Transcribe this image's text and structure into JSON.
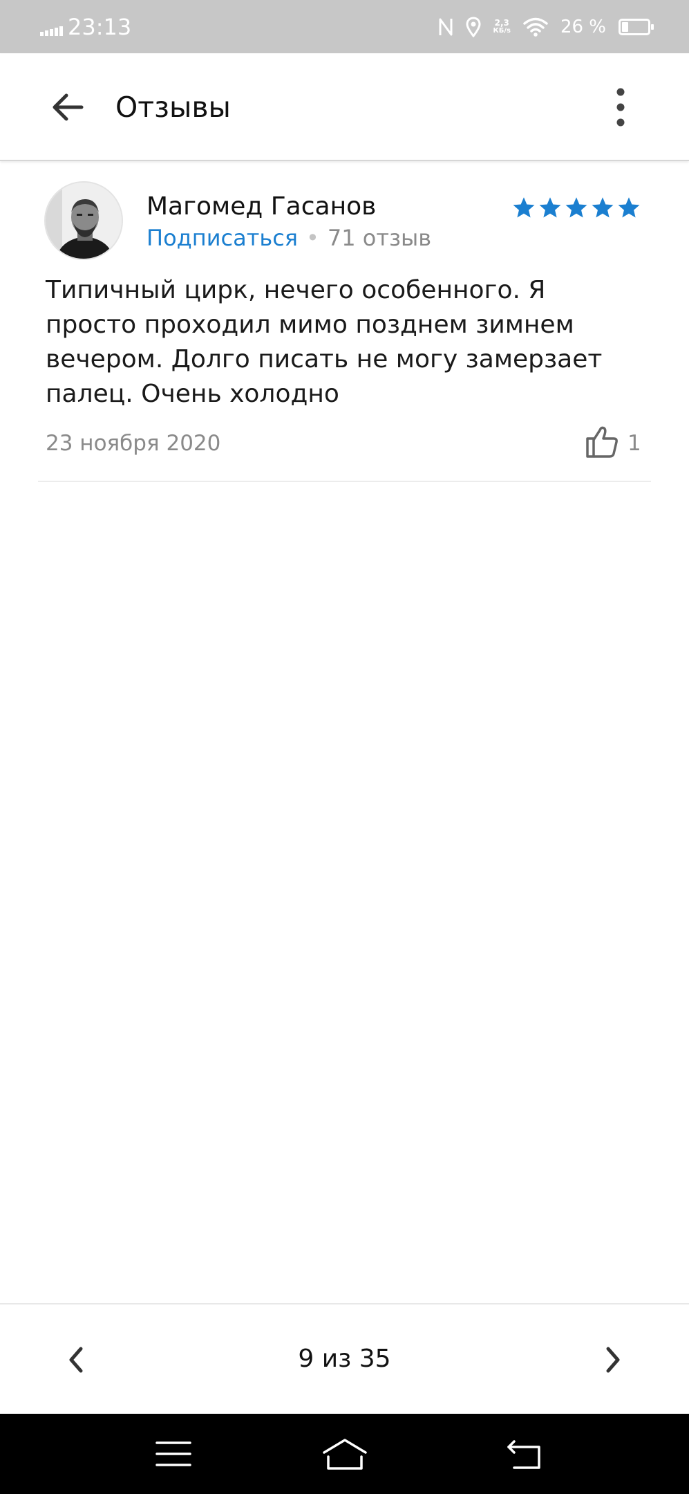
{
  "status_bar": {
    "time": "23:13",
    "speed_value": "2,3",
    "speed_unit": "КБ/s",
    "battery_percent": "26 %",
    "battery_level": 0.26,
    "icons": [
      "signal-icon",
      "nfc-icon",
      "location-icon",
      "wifi-icon",
      "battery-icon"
    ]
  },
  "app_bar": {
    "title": "Отзывы",
    "back_icon": "arrow-back-icon",
    "more_icon": "more-vert-icon"
  },
  "review": {
    "author": "Магомед Гасанов",
    "subscribe_label": "Подписаться",
    "separator": "•",
    "reviews_count": "71 отзыв",
    "rating": 5,
    "rating_max": 5,
    "text": "Типичный цирк, нечего особенного. Я просто проходил мимо позднем зимнем вечером. Долго писать не могу замерзает палец. Очень холодно",
    "date": "23 ноября 2020",
    "likes": "1",
    "star_color": "#1b7fd0",
    "link_color": "#1b7fd0"
  },
  "pager": {
    "text": "9 из 35",
    "prev_icon": "chevron-left-icon",
    "next_icon": "chevron-right-icon"
  },
  "nav_bar": {
    "icons": [
      "menu-icon",
      "home-icon",
      "back-nav-icon"
    ]
  }
}
